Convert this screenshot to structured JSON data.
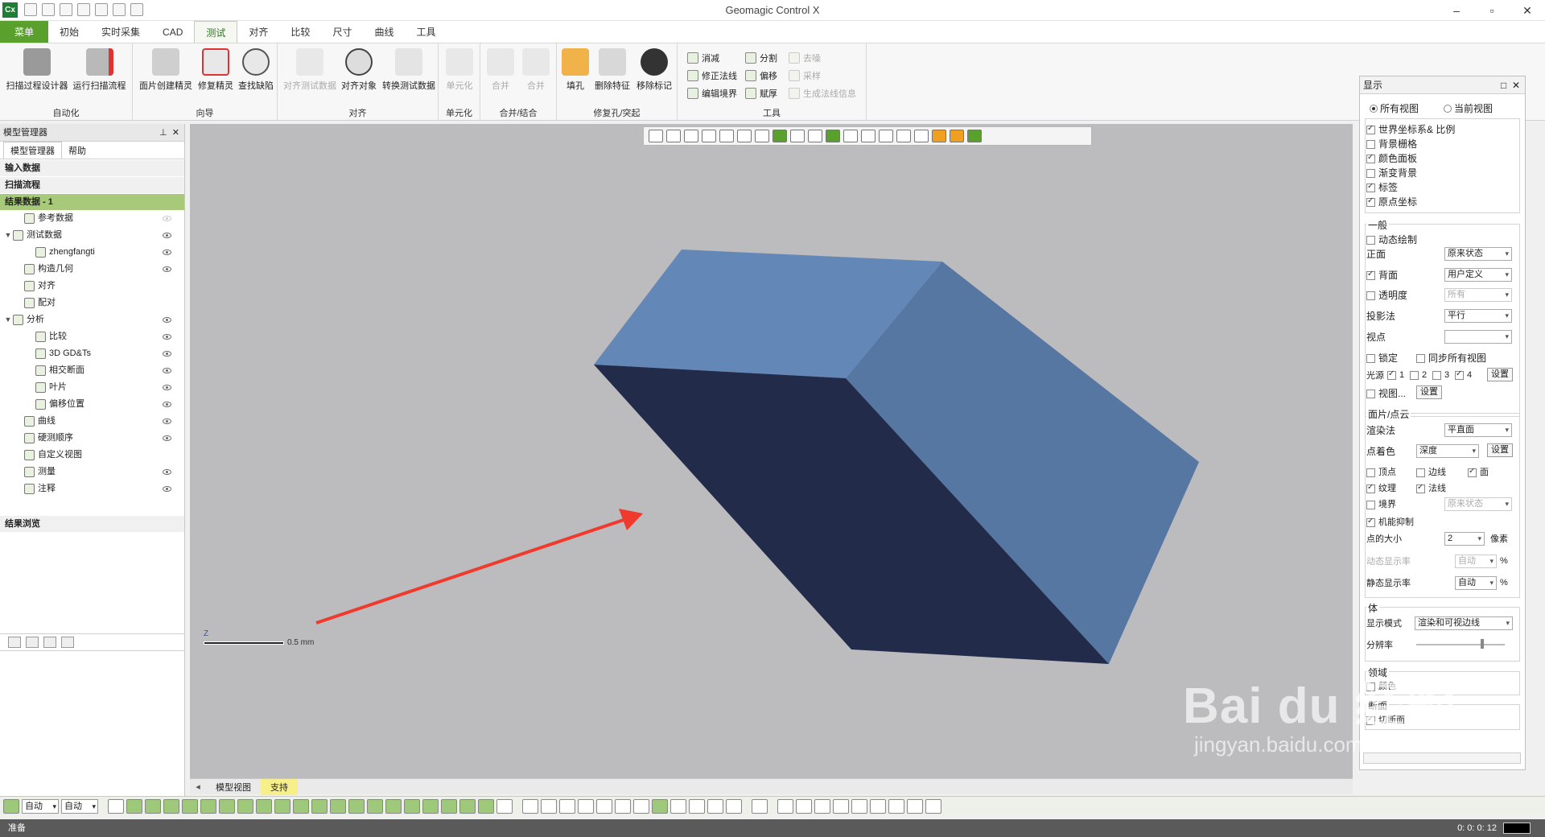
{
  "app": {
    "icon_label": "Cx",
    "title": "Geomagic Control X"
  },
  "ribbon_tabs": [
    "菜单",
    "初始",
    "实时采集",
    "CAD",
    "测试",
    "对齐",
    "比较",
    "尺寸",
    "曲线",
    "工具"
  ],
  "ribbon": {
    "groups": {
      "automation": "自动化",
      "wizard": "向导",
      "align": "对齐",
      "element": "单元化",
      "merge": "合并/结合",
      "repair": "修复孔/突起",
      "tools": "工具"
    },
    "buttons": {
      "scan_designer": "扫描过程设计器",
      "run_scan": "运行扫描流程",
      "mesh_create": "面片创建精灵",
      "repair_wizard": "修复精灵",
      "find_defects": "查找缺陷",
      "align_test_data": "对齐测试数据",
      "align_object": "对齐对象",
      "convert_test_data": "转换测试数据",
      "elementize": "单元化",
      "merge1": "合并",
      "merge2": "合并",
      "fill_hole": "填孔",
      "remove_feature": "删除特征",
      "remove_marker": "移除标记",
      "decimate": "消减",
      "fix_normals": "修正法线",
      "edit_boundary": "编辑境界",
      "split": "分割",
      "offset": "偏移",
      "thicken": "赋厚",
      "dedup": "去噪",
      "sample": "采样",
      "gen_normal_info": "生成法线信息"
    }
  },
  "left_panel": {
    "title": "模型管理器",
    "tabs": [
      "模型管理器",
      "帮助"
    ],
    "sections": {
      "input": "输入数据",
      "scan_flow": "扫描流程",
      "result": "结果数据 - 1",
      "result_browse": "结果浏览"
    },
    "tree": [
      {
        "label": "参考数据",
        "indent": 1,
        "expander": "",
        "eye": "dim"
      },
      {
        "label": "测试数据",
        "indent": 0,
        "expander": "▼",
        "eye": "on"
      },
      {
        "label": "zhengfangti",
        "indent": 2,
        "expander": "",
        "eye": "on"
      },
      {
        "label": "构造几何",
        "indent": 1,
        "expander": "",
        "eye": "on"
      },
      {
        "label": "对齐",
        "indent": 1,
        "expander": "",
        "eye": "none"
      },
      {
        "label": "配对",
        "indent": 1,
        "expander": "",
        "eye": "none"
      },
      {
        "label": "分析",
        "indent": 0,
        "expander": "▼",
        "eye": "on"
      },
      {
        "label": "比较",
        "indent": 2,
        "expander": "",
        "eye": "on"
      },
      {
        "label": "3D GD&Ts",
        "indent": 2,
        "expander": "",
        "eye": "on"
      },
      {
        "label": "相交断面",
        "indent": 2,
        "expander": "",
        "eye": "on"
      },
      {
        "label": "叶片",
        "indent": 2,
        "expander": "",
        "eye": "on"
      },
      {
        "label": "偏移位置",
        "indent": 2,
        "expander": "",
        "eye": "on"
      },
      {
        "label": "曲线",
        "indent": 1,
        "expander": "",
        "eye": "on"
      },
      {
        "label": "硬测顺序",
        "indent": 1,
        "expander": "",
        "eye": "on"
      },
      {
        "label": "自定义视图",
        "indent": 1,
        "expander": "",
        "eye": "none"
      },
      {
        "label": "测量",
        "indent": 1,
        "expander": "",
        "eye": "on"
      },
      {
        "label": "注释",
        "indent": 1,
        "expander": "",
        "eye": "on"
      }
    ]
  },
  "viewport": {
    "scale_label": "0.5 mm",
    "axis_z": "Z",
    "colors": {
      "background": "#bcbcbf",
      "face_top": "#6388b8",
      "face_right": "#5777a3",
      "face_bottom": "#222c4a",
      "arrow": "#f03a2e"
    }
  },
  "bottom_tabs": [
    "模型视图",
    "支持"
  ],
  "display_panel": {
    "title": "显示",
    "views": {
      "all": "所有视图",
      "current": "当前视图"
    },
    "scene_items": [
      {
        "label": "世界坐标系& 比例",
        "checked": true
      },
      {
        "label": "背景栅格",
        "checked": false
      },
      {
        "label": "颜色面板",
        "checked": true
      },
      {
        "label": "渐变背景",
        "checked": false
      },
      {
        "label": "标签",
        "checked": true
      },
      {
        "label": "原点坐标",
        "checked": true
      }
    ],
    "general": {
      "title": "一般",
      "dynamic_draw": "动态绘制",
      "front": "正面",
      "front_value": "原来状态",
      "back": "背面",
      "back_value": "用户定义",
      "transparency": "透明度",
      "transparency_value": "所有",
      "projection": "投影法",
      "projection_value": "平行",
      "viewpoint": "视点",
      "lock": "锁定",
      "sync_views": "同步所有视图",
      "light": "光源",
      "light_1": "1",
      "light_2": "2",
      "light_3": "3",
      "light_4": "4",
      "settings": "设置",
      "view_more": "视图...",
      "view_settings": "设置"
    },
    "mesh": {
      "title": "面片/点云",
      "render": "渲染法",
      "render_value": "平直面",
      "point_color": "点着色",
      "point_color_value": "深度",
      "settings": "设置",
      "vertex": "顶点",
      "edges": "边线",
      "face": "面",
      "texture": "纹理",
      "normals": "法线",
      "boundary": "境界",
      "boundary_value": "原来状态",
      "smart_suppress": "机能抑制",
      "point_size": "点的大小",
      "point_size_value": "2",
      "pixel": "像素",
      "dynamic_rate": "动态显示率",
      "dynamic_rate_value": "自动",
      "static_rate": "静态显示率",
      "static_rate_value": "自动",
      "percent": "%"
    },
    "body": {
      "title": "体",
      "mode": "显示模式",
      "mode_value": "渲染和可视边线",
      "resolution": "分辨率"
    },
    "region": {
      "title": "领域",
      "color": "颜色"
    },
    "section": {
      "title": "断面",
      "cut": "切断面"
    }
  },
  "bottom_toolbar": {
    "sel1": "自动",
    "sel2": "自动"
  },
  "status": {
    "text": "准备",
    "coords": "0: 0: 0: 12"
  },
  "watermark": {
    "big": "Bai du 经验",
    "small": "jingyan.baidu.com"
  }
}
